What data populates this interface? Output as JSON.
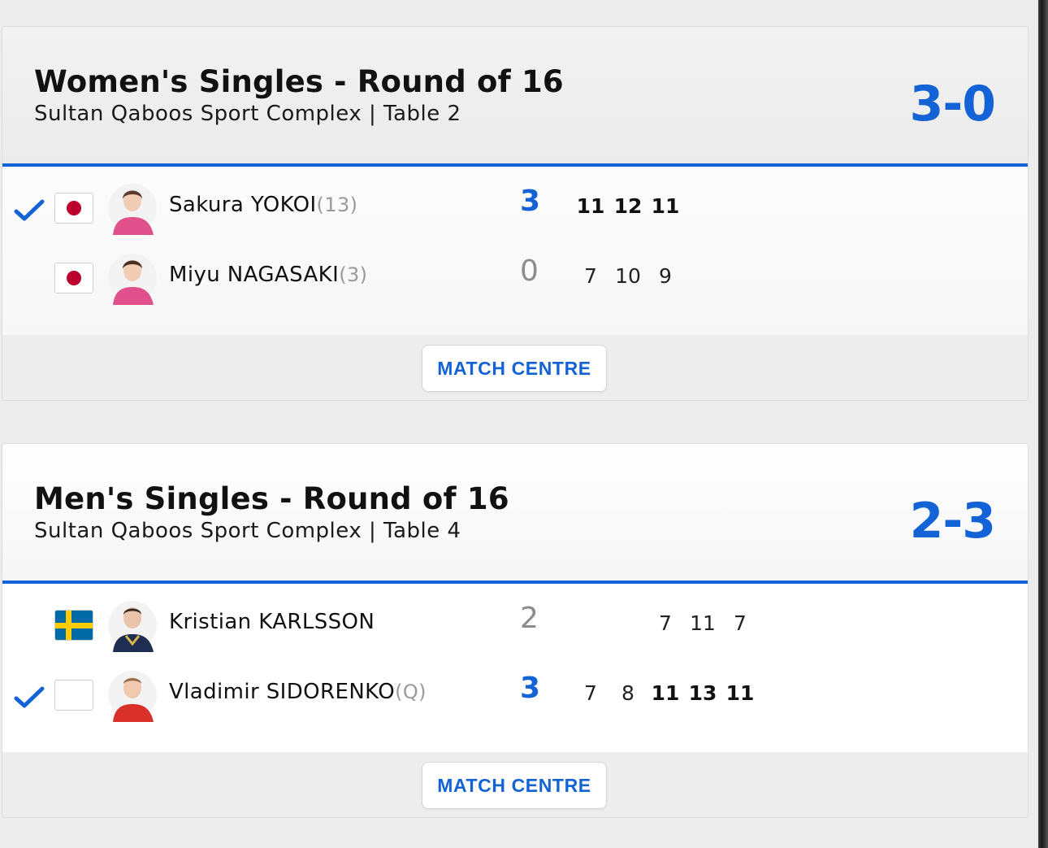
{
  "matches": [
    {
      "title": "Women's Singles - Round of 16",
      "venue": "Sultan Qaboos Sport Complex | Table 2",
      "score": "3-0",
      "players": [
        {
          "name": "Sakura YOKOI",
          "seed": "(13)",
          "sets": "3",
          "winner": true,
          "flag": "japan-flag-icon",
          "games": [
            "11",
            "12",
            "11"
          ]
        },
        {
          "name": "Miyu NAGASAKI",
          "seed": "(3)",
          "sets": "0",
          "winner": false,
          "flag": "japan-flag-icon",
          "games": [
            "7",
            "10",
            "9"
          ]
        }
      ],
      "button": "MATCH CENTRE"
    },
    {
      "title": "Men's Singles - Round of 16",
      "venue": "Sultan Qaboos Sport Complex | Table 4",
      "score": "2-3",
      "players": [
        {
          "name": "Kristian KARLSSON",
          "seed": "",
          "sets": "2",
          "winner": false,
          "flag": "sweden-flag-icon",
          "games": [
            "7",
            "11",
            "7"
          ]
        },
        {
          "name": "Vladimir SIDORENKO",
          "seed": "(Q)",
          "sets": "3",
          "winner": true,
          "flag": "blank-flag-icon",
          "games": [
            "7",
            "8",
            "11",
            "13",
            "11"
          ]
        }
      ],
      "button": "MATCH CENTRE"
    }
  ],
  "colors": {
    "accent": "#1463d6",
    "japan_red": "#bc002d",
    "sweden_blue": "#006aa7",
    "sweden_yellow": "#fecc00"
  }
}
